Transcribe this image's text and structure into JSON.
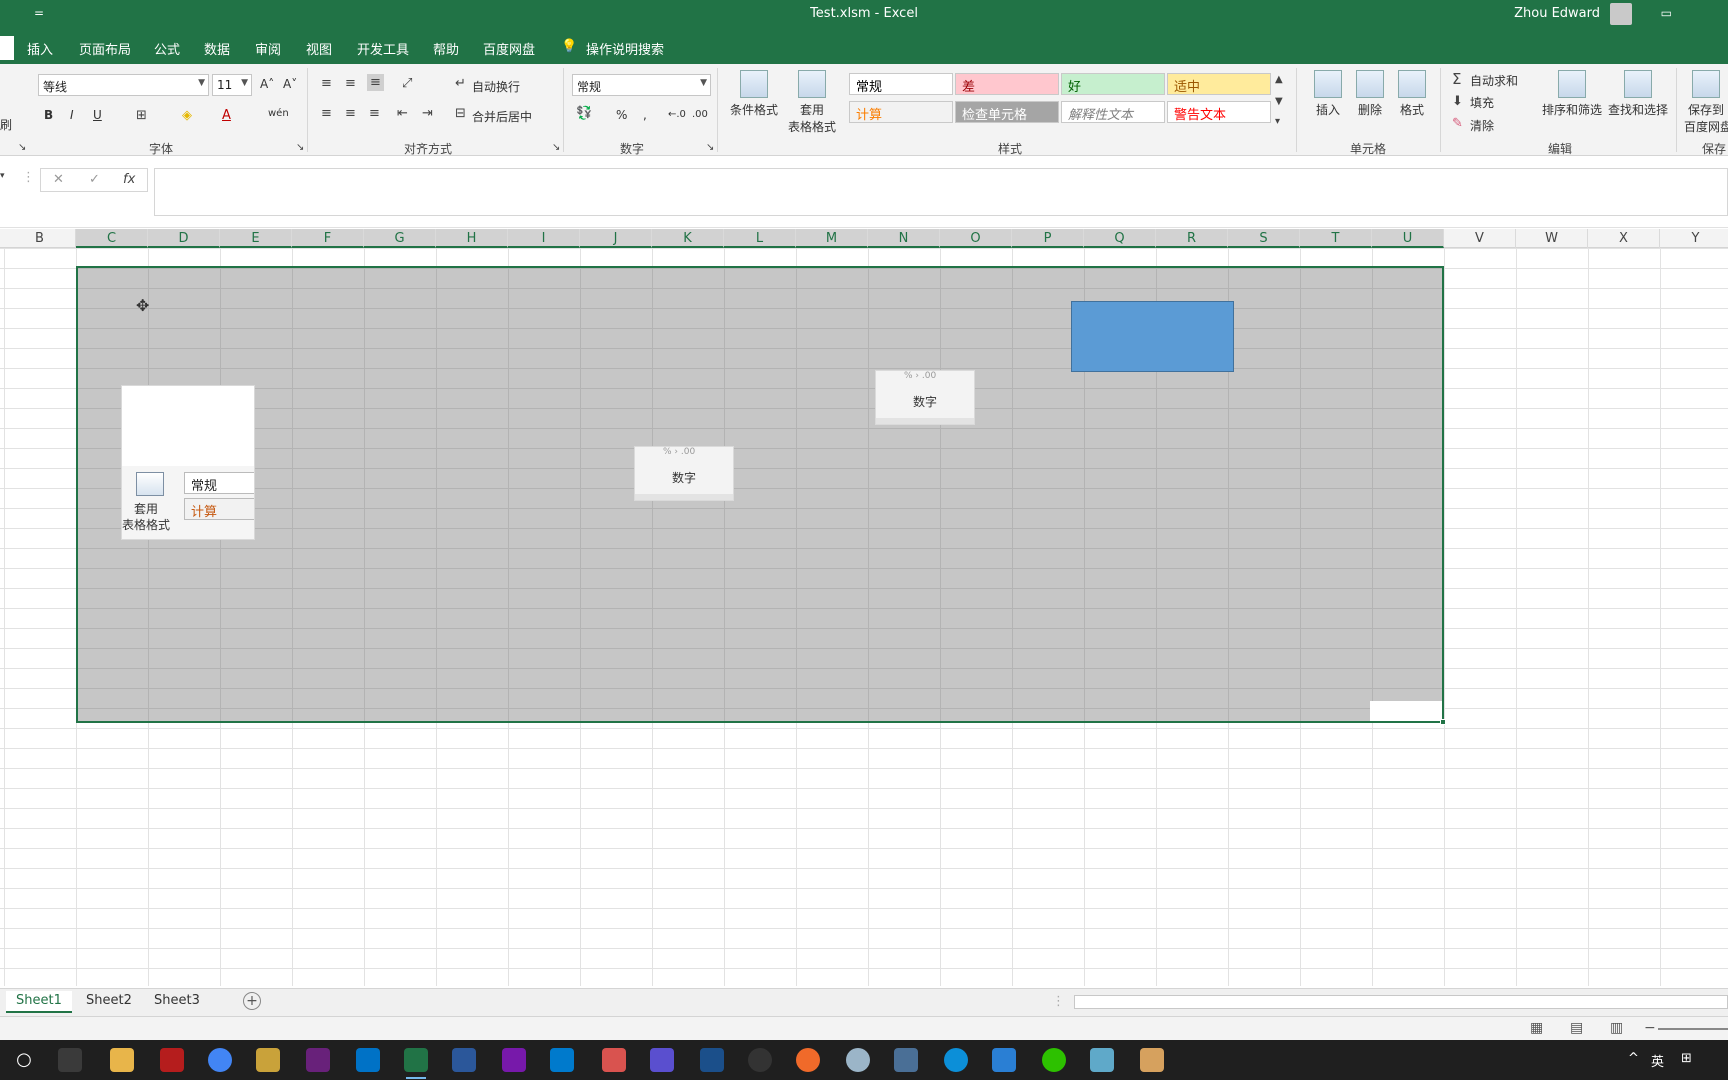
{
  "window": {
    "qat_symbol": "=",
    "title": "Test.xlsm  -  Excel",
    "user": "Zhou Edward",
    "ribbon_display_icon": "ribbon-display-options-icon"
  },
  "tabs": [
    {
      "label": "插入"
    },
    {
      "label": "页面布局"
    },
    {
      "label": "公式"
    },
    {
      "label": "数据"
    },
    {
      "label": "审阅"
    },
    {
      "label": "视图"
    },
    {
      "label": "开发工具"
    },
    {
      "label": "帮助"
    },
    {
      "label": "百度网盘"
    },
    {
      "label": "操作说明搜索"
    }
  ],
  "ribbon": {
    "clipboard_partial": "刷",
    "font": {
      "name": "等线",
      "size": "11",
      "grow": "A˄",
      "shrink": "A˅",
      "bold": "B",
      "italic": "I",
      "underline": "U",
      "wen": "wén",
      "group_label": "字体"
    },
    "alignment": {
      "wrap": "自动换行",
      "merge": "合并后居中",
      "group_label": "对齐方式"
    },
    "number": {
      "format": "常规",
      "percent": "%",
      "comma": ",",
      "inc_decimal": "←.0",
      "dec_decimal": ".00",
      "group_label": "数字"
    },
    "styles": {
      "conditional": "条件格式",
      "table_fmt_1": "套用",
      "table_fmt_2": "表格格式",
      "cells": [
        {
          "label": "常规",
          "bg": "#ffffff",
          "color": "#000000"
        },
        {
          "label": "差",
          "bg": "#ffc7ce",
          "color": "#9c0006"
        },
        {
          "label": "好",
          "bg": "#c6efce",
          "color": "#006100"
        },
        {
          "label": "适中",
          "bg": "#ffeb9c",
          "color": "#9c5700"
        },
        {
          "label": "计算",
          "bg": "#f2f2f2",
          "color": "#fa7d00"
        },
        {
          "label": "检查单元格",
          "bg": "#a5a5a5",
          "color": "#ffffff"
        },
        {
          "label": "解释性文本",
          "bg": "#ffffff",
          "color": "#7f7f7f"
        },
        {
          "label": "警告文本",
          "bg": "#ffffff",
          "color": "#ff0000"
        }
      ],
      "group_label": "样式"
    },
    "cells_group": {
      "insert": "插入",
      "delete": "删除",
      "format": "格式",
      "group_label": "单元格"
    },
    "editing": {
      "autosum": "自动求和",
      "fill": "填充",
      "clear": "清除",
      "sort": "排序和筛选",
      "find": "查找和选择",
      "group_label": "编辑"
    },
    "save": {
      "label1": "保存到",
      "label2": "百度网盘",
      "group_label": "保存"
    }
  },
  "formula_bar": {
    "cancel": "✕",
    "enter": "✓",
    "fx": "fx",
    "value": ""
  },
  "columns": [
    "B",
    "C",
    "D",
    "E",
    "F",
    "G",
    "H",
    "I",
    "J",
    "K",
    "L",
    "M",
    "N",
    "O",
    "P",
    "Q",
    "R",
    "S",
    "T",
    "U",
    "V",
    "W",
    "X",
    "Y"
  ],
  "selected_columns": [
    "C",
    "D",
    "E",
    "F",
    "G",
    "H",
    "I",
    "J",
    "K",
    "L",
    "M",
    "N",
    "O",
    "P",
    "Q",
    "R",
    "S",
    "T",
    "U"
  ],
  "sheet_objects": {
    "pic1": {
      "table_fmt_1": "套用",
      "table_fmt_2": "表格格式",
      "cell1": "常规",
      "cell2": "计算"
    },
    "pic2": {
      "frag": "% › .00",
      "label": "数字"
    },
    "pic3": {
      "frag": "% › .00",
      "label": "数字"
    }
  },
  "sheets": [
    {
      "label": "Sheet1",
      "active": true
    },
    {
      "label": "Sheet2",
      "active": false
    },
    {
      "label": "Sheet3",
      "active": false
    }
  ],
  "status": {
    "view_normal": "▦",
    "view_layout": "▤",
    "view_break": "▥",
    "zoom_out": "−"
  },
  "taskbar": {
    "start": "○",
    "tray_ime": "英",
    "tray_caret": "^"
  }
}
